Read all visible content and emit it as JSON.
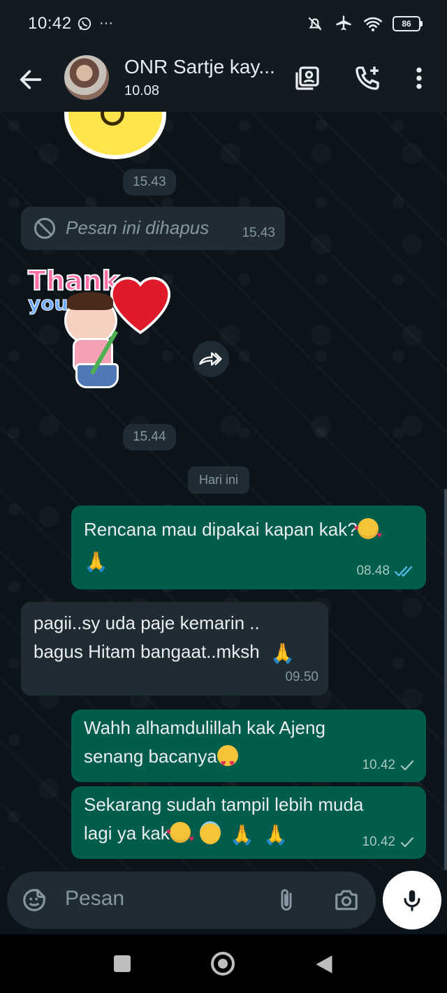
{
  "status_bar": {
    "time": "10:42",
    "dots": "···",
    "battery": "86"
  },
  "header": {
    "contact_name": "ONR Sartje kay...",
    "subtitle": "10.08"
  },
  "chat": {
    "messages": [
      {
        "type": "time",
        "time": "15.43"
      },
      {
        "type": "deleted",
        "direction": "in",
        "text": "Pesan ini dihapus",
        "time": "15.43"
      },
      {
        "type": "sticker",
        "direction": "in",
        "caption_line1": "Thank",
        "caption_line2": "you"
      },
      {
        "type": "time",
        "time": "15.44"
      },
      {
        "type": "day",
        "label": "Hari ini"
      },
      {
        "type": "text",
        "direction": "out",
        "line1": "Rencana mau dipakai kapan kak?",
        "time": "08.48",
        "status": "read"
      },
      {
        "type": "text",
        "direction": "in",
        "line1": "pagii..sy uda paje kemarin ..",
        "line2": "bagus Hitam bangaat..mksh",
        "time": "09.50"
      },
      {
        "type": "text",
        "direction": "out",
        "line1": "Wahh alhamdulillah kak Ajeng",
        "line2": "senang bacanya",
        "time": "10.42",
        "status": "sent"
      },
      {
        "type": "text",
        "direction": "out",
        "line1": "Sekarang sudah tampil lebih muda",
        "line2": "lagi ya kak",
        "time": "10.42",
        "status": "sent"
      }
    ]
  },
  "input": {
    "placeholder": "Pesan"
  },
  "colors": {
    "background": "#0b141a",
    "header": "#111b21",
    "incoming": "#1f2c34",
    "outgoing": "#005c4b",
    "read_tick": "#53bdeb"
  },
  "icons": [
    "whatsapp-icon",
    "mute-icon",
    "airplane-icon",
    "wifi-icon",
    "battery-icon",
    "back-arrow-icon",
    "contact-card-icon",
    "add-call-icon",
    "more-vert-icon",
    "blocked-icon",
    "forward-icon",
    "read-ticks-icon",
    "sent-tick-icon",
    "emoji-sticker-icon",
    "attach-icon",
    "camera-icon",
    "mic-icon",
    "nav-recents-icon",
    "nav-home-icon",
    "nav-back-icon"
  ]
}
